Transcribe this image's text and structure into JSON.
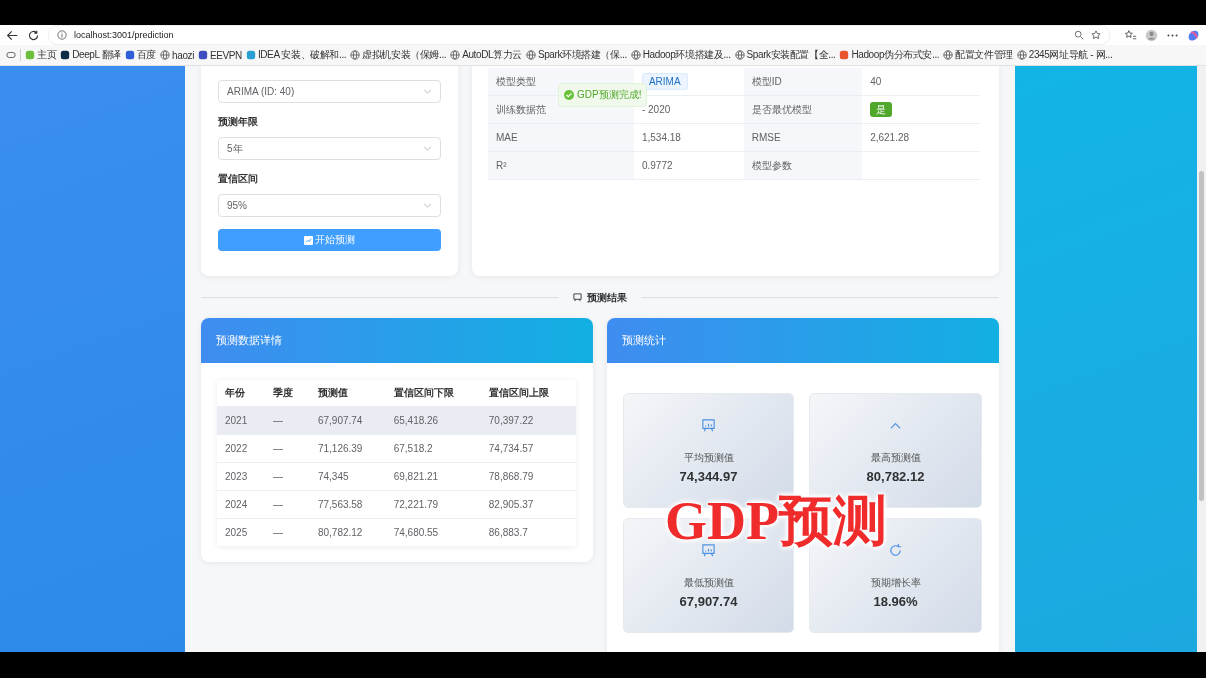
{
  "browser": {
    "url": "localhost:3001/prediction",
    "bookmarks": [
      {
        "label": "主页",
        "kind": "site",
        "color": "#6cbf3a"
      },
      {
        "label": "DeepL 翻译",
        "kind": "site",
        "color": "#0f2b46"
      },
      {
        "label": "百度",
        "kind": "site",
        "color": "#2f5fd8"
      },
      {
        "label": "haozi",
        "kind": "globe"
      },
      {
        "label": "EEVPN",
        "kind": "site",
        "color": "#3b4cc0"
      },
      {
        "label": "IDEA 安装、破解和...",
        "kind": "site",
        "color": "#2a9fd6"
      },
      {
        "label": "虚拟机安装（保姆...",
        "kind": "globe"
      },
      {
        "label": "AutoDL算力云",
        "kind": "globe"
      },
      {
        "label": "Spark环境搭建（保...",
        "kind": "globe"
      },
      {
        "label": "Hadoop环境搭建及...",
        "kind": "globe"
      },
      {
        "label": "Spark安装配置【全...",
        "kind": "globe"
      },
      {
        "label": "Hadoop伪分布式安...",
        "kind": "site",
        "color": "#e8562e"
      },
      {
        "label": "配置文件管理",
        "kind": "globe"
      },
      {
        "label": "2345网址导航 - 网...",
        "kind": "globe"
      }
    ]
  },
  "form": {
    "fields": [
      {
        "value": "ARIMA (ID: 40)"
      },
      {
        "label": "预测年限",
        "value": "5年"
      },
      {
        "label": "置信区间",
        "value": "95%"
      }
    ],
    "button": "开始预测"
  },
  "model_info": {
    "rows": [
      [
        {
          "label": "模型类型",
          "value": "ARIMA",
          "kind": "tag"
        },
        {
          "label": "模型ID",
          "value": "40",
          "kind": "text"
        }
      ],
      [
        {
          "label": "训练数据范",
          "value": "- 2020",
          "kind": "text"
        },
        {
          "label": "是否最优模型",
          "value": "是",
          "kind": "badge"
        }
      ],
      [
        {
          "label": "MAE",
          "value": "1,534.18",
          "kind": "text"
        },
        {
          "label": "RMSE",
          "value": "2,621.28",
          "kind": "text"
        }
      ],
      [
        {
          "label": "R²",
          "value": "0.9772",
          "kind": "text"
        },
        {
          "label": "模型参数",
          "kind": "text"
        }
      ]
    ]
  },
  "toast": {
    "message": "GDP预测完成!"
  },
  "section_divider": "预测结果",
  "detail_card": {
    "title": "预测数据详情",
    "columns": [
      "年份",
      "季度",
      "预测值",
      "置信区间下限",
      "置信区间上限"
    ],
    "rows": [
      {
        "cells": [
          "2021",
          "—",
          "67,907.74",
          "65,418.26",
          "70,397.22"
        ],
        "selected": true
      },
      {
        "cells": [
          "2022",
          "—",
          "71,126.39",
          "67,518.2",
          "74,734.57"
        ],
        "selected": false
      },
      {
        "cells": [
          "2023",
          "—",
          "74,345",
          "69,821.21",
          "78,868.79"
        ],
        "selected": false
      },
      {
        "cells": [
          "2024",
          "—",
          "77,563.58",
          "72,221.79",
          "82,905.37"
        ],
        "selected": false
      },
      {
        "cells": [
          "2025",
          "—",
          "80,782.12",
          "74,680.55",
          "86,883.7"
        ],
        "selected": false
      }
    ]
  },
  "stats_card": {
    "title": "预测统计",
    "stats": [
      {
        "label": "平均预测值",
        "value": "74,344.97",
        "kind": "board"
      },
      {
        "label": "最高预测值",
        "value": "80,782.12",
        "kind": "up"
      },
      {
        "label": "最低预测值",
        "value": "67,907.74",
        "kind": "board"
      },
      {
        "label": "预期增长率",
        "value": "18.96%",
        "kind": "cycle"
      }
    ]
  },
  "overlay_title": "GDP预测"
}
